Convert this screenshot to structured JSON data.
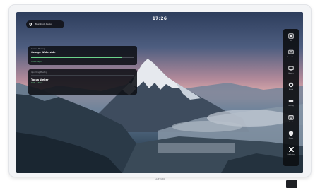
{
  "screen": {
    "time": "17:26",
    "room_label": "Boardroom Demo"
  },
  "current_meeting": {
    "kicker": "Current Meeting",
    "title": "George Waterside",
    "status": "Until 1:00pm",
    "progress": 0.88
  },
  "upcoming_meeting": {
    "kicker": "Upcoming Meeting",
    "title": "Tanya Weber",
    "status": "3:00 - 3:30pm"
  },
  "toolbar": {
    "items": [
      {
        "icon": "whiteboard-icon",
        "label": "Files"
      },
      {
        "icon": "share-screen-icon",
        "label": "Screen Share"
      },
      {
        "icon": "display-icon",
        "label": "Browser"
      },
      {
        "icon": "record-icon",
        "label": "Record"
      },
      {
        "icon": "meeting-icon",
        "label": "Meeting"
      },
      {
        "icon": "calendar-icon",
        "label": "Cancel"
      },
      {
        "icon": "shield-icon",
        "label": "Privacy"
      },
      {
        "icon": "close-icon",
        "label": "End Session"
      }
    ]
  },
  "device": {
    "brand": "SAMSUNG"
  },
  "colors": {
    "accent_green": "#6bd38b",
    "panel_bg": "#0e1016"
  }
}
